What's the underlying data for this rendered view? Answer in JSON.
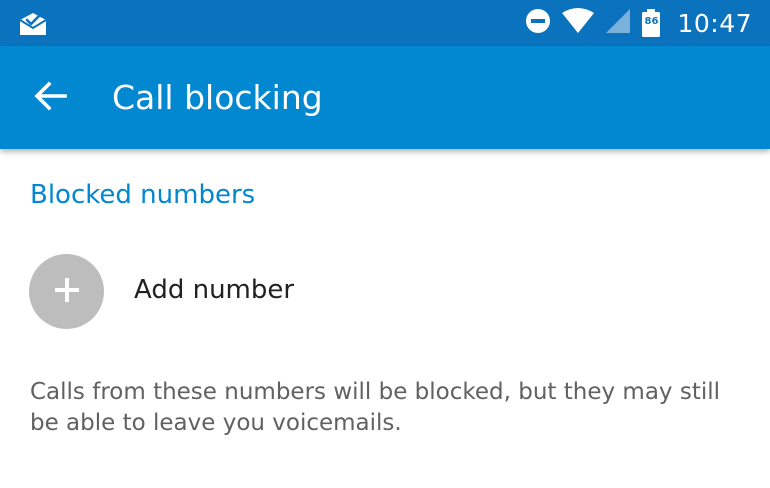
{
  "status_bar": {
    "time": "10:47",
    "battery_level": "86",
    "bg_color": "#0b72bd",
    "icons": [
      "mail-check-icon",
      "do-not-disturb-icon",
      "wifi-icon",
      "cell-signal-icon",
      "battery-icon"
    ]
  },
  "app_bar": {
    "title": "Call blocking",
    "bg_color": "#0288d1",
    "back_icon": "arrow-back-icon"
  },
  "blocked_numbers": {
    "header": "Blocked numbers",
    "add_label": "Add number",
    "add_icon": "plus-icon",
    "description": "Calls from these numbers will be blocked, but they may still be able to leave you voicemails."
  }
}
